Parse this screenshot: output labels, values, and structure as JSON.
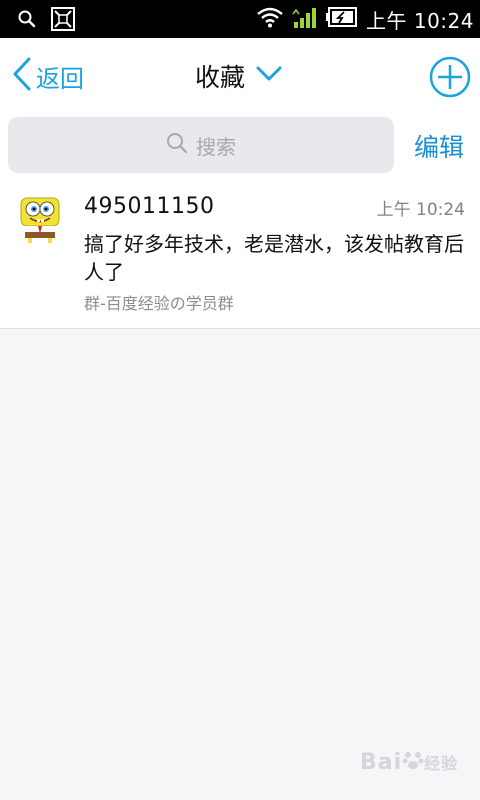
{
  "status_bar": {
    "time": "上午 10:24",
    "icons": [
      "search-icon",
      "gallery-icon",
      "wifi-icon",
      "signal-icon",
      "battery-icon"
    ]
  },
  "header": {
    "back_label": "返回",
    "title": "收藏",
    "icons": [
      "chevron-left-icon",
      "chevron-down-icon",
      "add-circle-icon"
    ],
    "accent_color": "#1ba3e0"
  },
  "search": {
    "placeholder": "搜索",
    "edit_label": "编辑"
  },
  "favorites": [
    {
      "sender": "495011150",
      "time": "上午 10:24",
      "message": "搞了好多年技术，老是潜水，该发帖教育后人了",
      "source": "群-百度经验の学员群"
    }
  ],
  "watermark": {
    "text": "Bai",
    "suffix": "经验"
  }
}
